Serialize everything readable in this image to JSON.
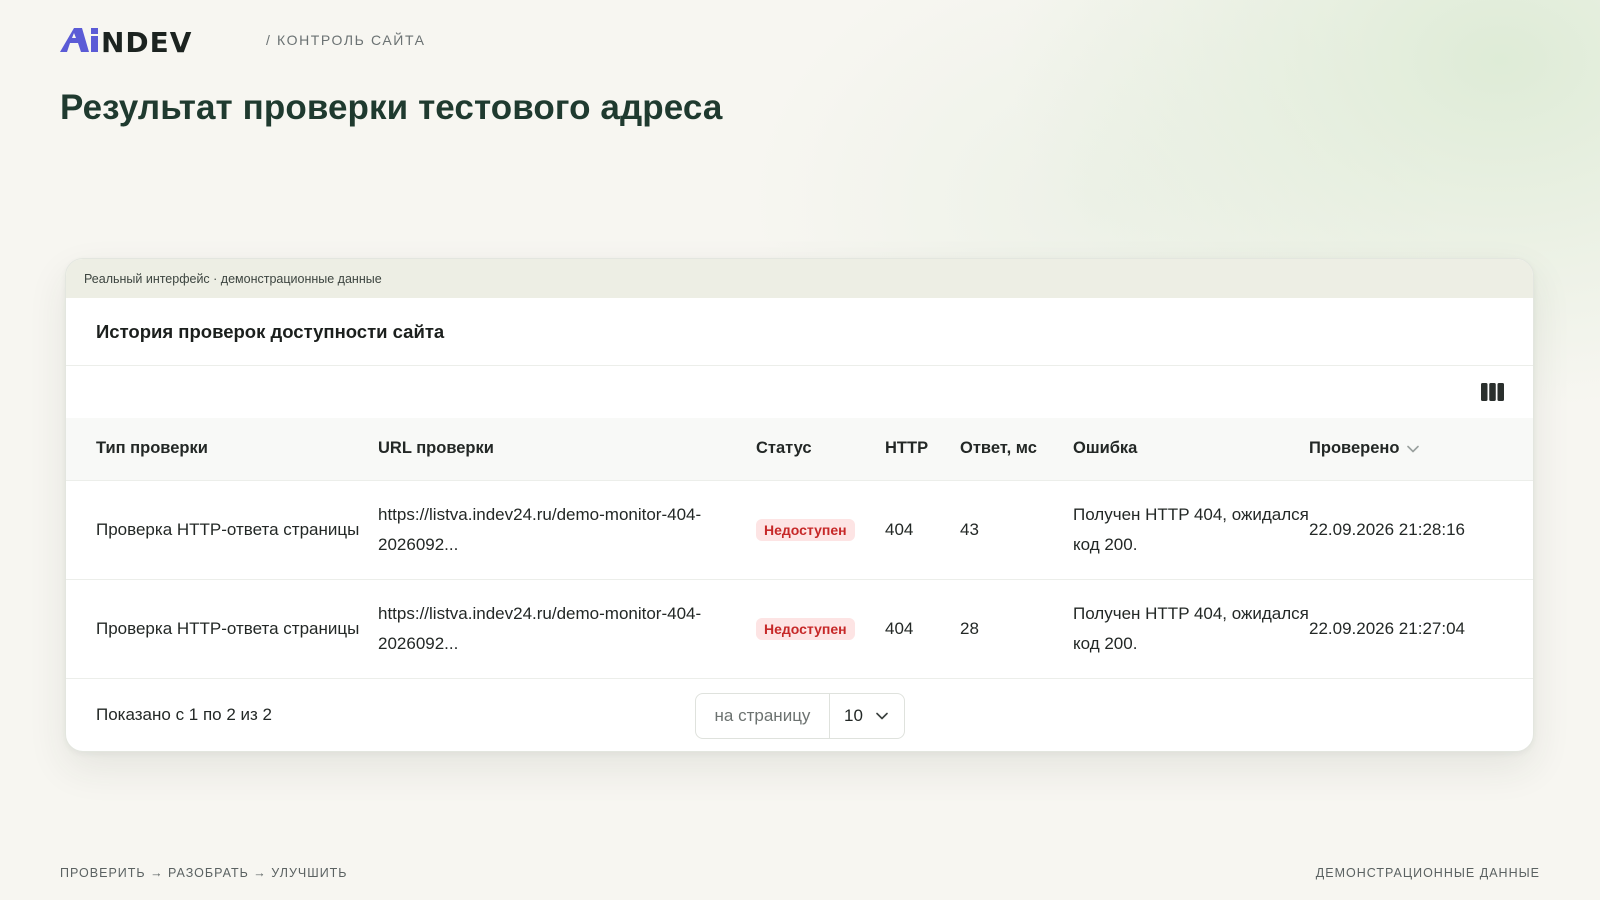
{
  "header": {
    "logo_text": "AiNDEV",
    "breadcrumb": "/ КОНТРОЛЬ САЙТА"
  },
  "page_title": "Результат проверки тестового адреса",
  "card": {
    "strip_text": "Реальный интерфейс · демонстрационные данные",
    "title": "История проверок доступности сайта",
    "columns_icon": "columns-icon",
    "table": {
      "headers": [
        "Тип проверки",
        "URL проверки",
        "Статус",
        "HTTP",
        "Ответ, мс",
        "Ошибка",
        "Проверено"
      ],
      "sort_icon": "chevron-down-icon",
      "rows": [
        {
          "type": "Проверка HTTP-ответа страницы",
          "url": "https://listva.indev24.ru/demo-monitor-404-2026092...",
          "status": "Недоступен",
          "http": "404",
          "response_ms": "43",
          "error": "Получен HTTP 404, ожидался код 200.",
          "checked": "22.09.2026 21:28:16"
        },
        {
          "type": "Проверка HTTP-ответа страницы",
          "url": "https://listva.indev24.ru/demo-monitor-404-2026092...",
          "status": "Недоступен",
          "http": "404",
          "response_ms": "28",
          "error": "Получен HTTP 404, ожидался код 200.",
          "checked": "22.09.2026 21:27:04"
        }
      ]
    },
    "footer": {
      "shown": "Показано с 1 по 2 из 2",
      "per_page_label": "на страницу",
      "per_page_value": "10"
    }
  },
  "page_footer": {
    "left": "ПРОВЕРИТЬ → РАЗОБРАТЬ → УЛУЧШИТЬ",
    "right": "ДЕМОНСТРАЦИОННЫЕ ДАННЫЕ"
  },
  "colors": {
    "title": "#1f3a2f",
    "logo_accent": "#5b5bd6",
    "logo_text": "#1c2320",
    "badge_bg": "#fde4e4",
    "badge_text": "#c62828",
    "strip_bg": "#edeee4"
  }
}
